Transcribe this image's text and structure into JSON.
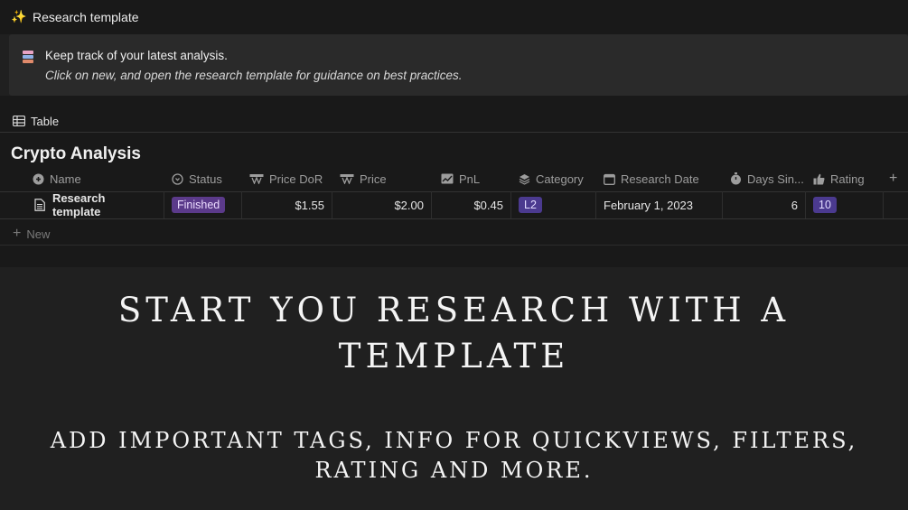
{
  "page": {
    "title": "Research template",
    "icon": "sparkle-icon"
  },
  "callout": {
    "icon": "books-icon",
    "title": "Keep track of your latest analysis.",
    "subtitle": "Click on new, and open the research template for guidance on best practices."
  },
  "view": {
    "tab_label": "Table",
    "tab_icon": "table-icon"
  },
  "database": {
    "title": "Crypto Analysis",
    "columns": [
      {
        "label": "Name",
        "icon": "name-icon"
      },
      {
        "label": "Status",
        "icon": "status-icon"
      },
      {
        "label": "Price DoR",
        "icon": "formula-icon"
      },
      {
        "label": "Price",
        "icon": "formula-icon"
      },
      {
        "label": "PnL",
        "icon": "chart-icon"
      },
      {
        "label": "Category",
        "icon": "layers-icon"
      },
      {
        "label": "Research Date",
        "icon": "calendar-icon"
      },
      {
        "label": "Days Sin...",
        "icon": "timer-icon"
      },
      {
        "label": "Rating",
        "icon": "thumbs-up-icon"
      }
    ],
    "add_column_label": "+",
    "rows": [
      {
        "name": "Research template",
        "status": "Finished",
        "price_dor": "$1.55",
        "price": "$2.00",
        "pnl": "$0.45",
        "category": "L2",
        "research_date": "February 1, 2023",
        "days_since": "6",
        "rating": "10"
      }
    ],
    "new_label": "New"
  },
  "overlay": {
    "headline": "START YOU RESEARCH WITH A TEMPLATE",
    "subline": "ADD IMPORTANT TAGS, INFO FOR QUICKVIEWS, FILTERS, RATING AND MORE."
  },
  "colors": {
    "background": "#202020",
    "status_badge": "#5b3a8a",
    "category_badge": "#4b3a8f",
    "rating_badge": "#4b3a8f"
  }
}
